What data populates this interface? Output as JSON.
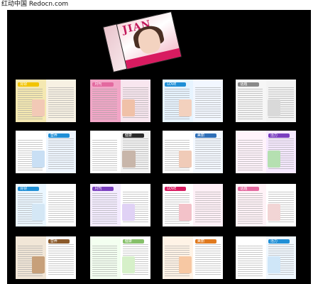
{
  "watermark": {
    "text": "红动中国 Redocn.com"
  },
  "hero": {
    "cover_title": "JIAN"
  },
  "colors": {
    "background": "#000000",
    "pink": "#e46aa0",
    "magenta": "#d81b60",
    "blue": "#1f8fd6",
    "purple": "#7b3fbf",
    "green": "#86c06a",
    "orange": "#e07a1f",
    "gray_text": "#9a9a9a"
  },
  "rows": [
    {
      "spreads": [
        {
          "name": "spread-1-1",
          "left": "#f4e8b1",
          "right": "#f7f1e3",
          "accent": "#f2c400",
          "photo": "#f2c9b6"
        },
        {
          "name": "spread-1-2",
          "left": "#f2a6c7",
          "right": "#f8e6ef",
          "accent": "#e46aa0",
          "photo": "#f0c1a8"
        },
        {
          "name": "spread-1-3",
          "left": "#e7f4ff",
          "right": "#f2f7ff",
          "accent": "#1f8fd6",
          "photo": "#f3d1be"
        },
        {
          "name": "spread-1-4",
          "left": "#f6f6f6",
          "right": "#f3f3f3",
          "accent": "#8a8a8a",
          "photo": "#d9d9d9"
        }
      ]
    },
    {
      "spreads": [
        {
          "name": "spread-2-1",
          "left": "#ffffff",
          "right": "#eef6ff",
          "accent": "#1f8fd6",
          "photo": "#c9dff4"
        },
        {
          "name": "spread-2-2",
          "left": "#ffffff",
          "right": "#f2f2f2",
          "accent": "#2a2a2a",
          "photo": "#c8b6aa"
        },
        {
          "name": "spread-2-3",
          "left": "#ffffff",
          "right": "#f3f8ff",
          "accent": "#2f6fb7",
          "photo": "#f0cbb8"
        },
        {
          "name": "spread-2-4",
          "left": "#fff3fb",
          "right": "#f6e9ff",
          "accent": "#7b3fbf",
          "photo": "#b5e0b1"
        }
      ]
    },
    {
      "spreads": [
        {
          "name": "spread-3-1",
          "left": "#eaf6ff",
          "right": "#ffffff",
          "accent": "#1f8fd6",
          "photo": "#d4e7f5"
        },
        {
          "name": "spread-3-2",
          "left": "#f4ecff",
          "right": "#ffffff",
          "accent": "#7b3fbf",
          "photo": "#e0d2f5"
        },
        {
          "name": "spread-3-3",
          "left": "#ffffff",
          "right": "#fff0f7",
          "accent": "#d81b60",
          "photo": "#f3c2c9"
        },
        {
          "name": "spread-3-4",
          "left": "#fff2f7",
          "right": "#ffffff",
          "accent": "#e46aa0",
          "photo": "#f2d5d5"
        }
      ]
    },
    {
      "spreads": [
        {
          "name": "spread-4-1",
          "left": "#f1e6d7",
          "right": "#ffffff",
          "accent": "#8b5a2b",
          "photo": "#c7a07a"
        },
        {
          "name": "spread-4-2",
          "left": "#f3fff0",
          "right": "#ffffff",
          "accent": "#86c06a",
          "photo": "#d6f0c9"
        },
        {
          "name": "spread-4-3",
          "left": "#fff3e6",
          "right": "#ffffff",
          "accent": "#e07a1f",
          "photo": "#f7c8a3"
        },
        {
          "name": "spread-4-4",
          "left": "#ffffff",
          "right": "#f0f8ff",
          "accent": "#1f8fd6",
          "photo": "#cfe6f8"
        }
      ]
    }
  ],
  "page_labels": [
    {
      "text": "好好"
    },
    {
      "text": "月刊"
    },
    {
      "text": "LOVE"
    },
    {
      "text": "话题"
    },
    {
      "text": "营养"
    },
    {
      "text": "健康"
    },
    {
      "text": "美丽"
    },
    {
      "text": "活力"
    }
  ]
}
